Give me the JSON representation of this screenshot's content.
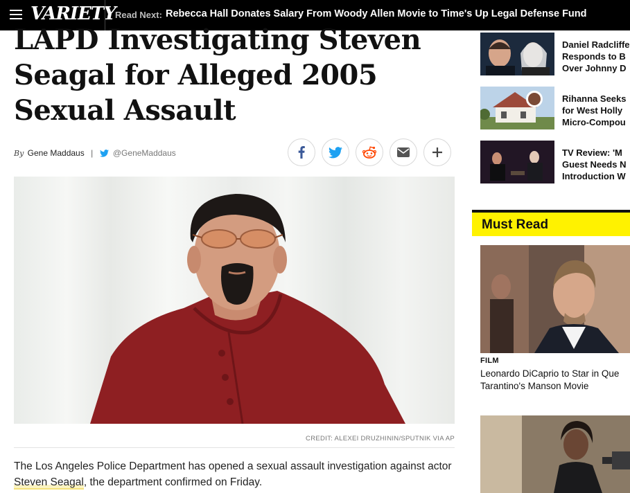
{
  "header": {
    "logo": "VARIETY",
    "read_next_label": "Read Next:",
    "read_next_title": "Rebecca Hall Donates Salary From Woody Allen Movie to Time's Up Legal Defense Fund"
  },
  "article": {
    "headline": "LAPD Investigating Steven Seagal for Alleged 2005 Sexual Assault",
    "byline_prefix": "By",
    "author": "Gene Maddaus",
    "twitter_handle": "@GeneMaddaus",
    "share_icons": [
      "facebook-icon",
      "twitter-icon",
      "reddit-icon",
      "email-icon",
      "plus-icon"
    ],
    "photo_credit": "CREDIT: ALEXEI DRUZHININ/SPUTNIK VIA AP",
    "lede_before": "The Los Angeles Police Department has opened a sexual assault investigation against actor ",
    "lede_link": "Steven Seagal",
    "lede_after": ", the department confirmed on Friday."
  },
  "rail": {
    "items": [
      {
        "title_lines": [
          "Daniel Radcliffe",
          "Responds to B",
          "Over Johnny D"
        ]
      },
      {
        "title_lines": [
          "Rihanna Seeks",
          "for West Holly",
          "Micro-Compou"
        ]
      },
      {
        "title_lines": [
          "TV Review: 'M",
          "Guest Needs N",
          "Introduction W"
        ]
      }
    ],
    "must_read_label": "Must Read",
    "must_read_category": "FILM",
    "must_read_title_lines": [
      "Leonardo DiCaprio to Star in Que",
      "Tarantino's Manson Movie"
    ]
  },
  "colors": {
    "topbar": "#000000",
    "must_read_bg": "#fff200",
    "twitter": "#1da1f2",
    "facebook": "#3b5998",
    "reddit": "#ff4500"
  }
}
